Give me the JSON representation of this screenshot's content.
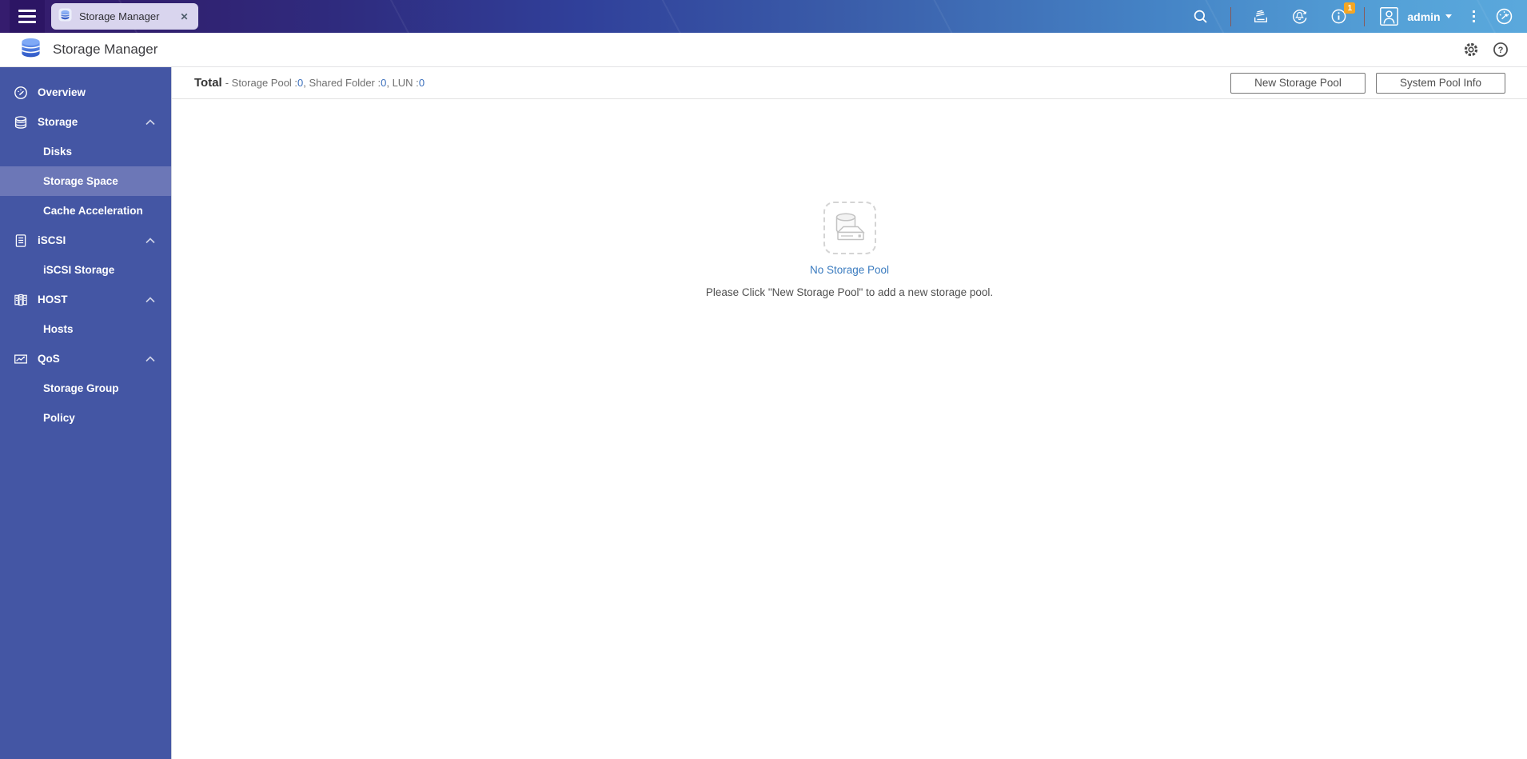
{
  "topbar": {
    "tab_label": "Storage Manager",
    "tab_close": "✕",
    "user_name": "admin",
    "event_badge": "1",
    "icons": [
      "main-menu-icon",
      "search-icon",
      "background-tasks-icon",
      "notification-refresh-icon",
      "event-info-icon",
      "user-avatar-icon",
      "more-options-icon",
      "dashboard-icon"
    ]
  },
  "header": {
    "title": "Storage Manager",
    "icons": [
      "storage-manager-app-icon",
      "gear-icon",
      "help-icon"
    ]
  },
  "sidebar": {
    "items": [
      {
        "label": "Overview",
        "type": "section",
        "icon": "gauge-icon"
      },
      {
        "label": "Storage",
        "type": "section",
        "icon": "database-icon",
        "expanded": true
      },
      {
        "label": "Disks",
        "type": "sub"
      },
      {
        "label": "Storage Space",
        "type": "sub",
        "selected": true
      },
      {
        "label": "Cache Acceleration",
        "type": "sub"
      },
      {
        "label": "iSCSI",
        "type": "section",
        "icon": "document-icon",
        "expanded": true
      },
      {
        "label": "iSCSI Storage",
        "type": "sub"
      },
      {
        "label": "HOST",
        "type": "section",
        "icon": "host-racks-icon",
        "expanded": true
      },
      {
        "label": "Hosts",
        "type": "sub"
      },
      {
        "label": "QoS",
        "type": "section",
        "icon": "qos-chart-icon",
        "expanded": true
      },
      {
        "label": "Storage Group",
        "type": "sub"
      },
      {
        "label": "Policy",
        "type": "sub"
      }
    ]
  },
  "toolbar": {
    "summary": {
      "total": "Total",
      "p1": "- Storage Pool :",
      "v1": "0",
      "p2": ", Shared Folder :",
      "v2": "0",
      "p3": ", LUN :",
      "v3": "0"
    },
    "new_storage_pool": "New Storage Pool",
    "system_pool_info": "System Pool Info"
  },
  "empty_state": {
    "title": "No Storage Pool",
    "message": "Please Click \"New Storage Pool\" to add a new storage pool."
  },
  "colors": {
    "topbar_left": "#351c6e",
    "topbar_right": "#5aa8dc",
    "sidebar": "#4456a4",
    "sidebar_selected": "#6c77b7",
    "tab_bg": "#d9d5ee",
    "badge_orange": "#f5a623",
    "value_blue": "#3b6fbc",
    "link_blue": "#3a7bbf"
  }
}
